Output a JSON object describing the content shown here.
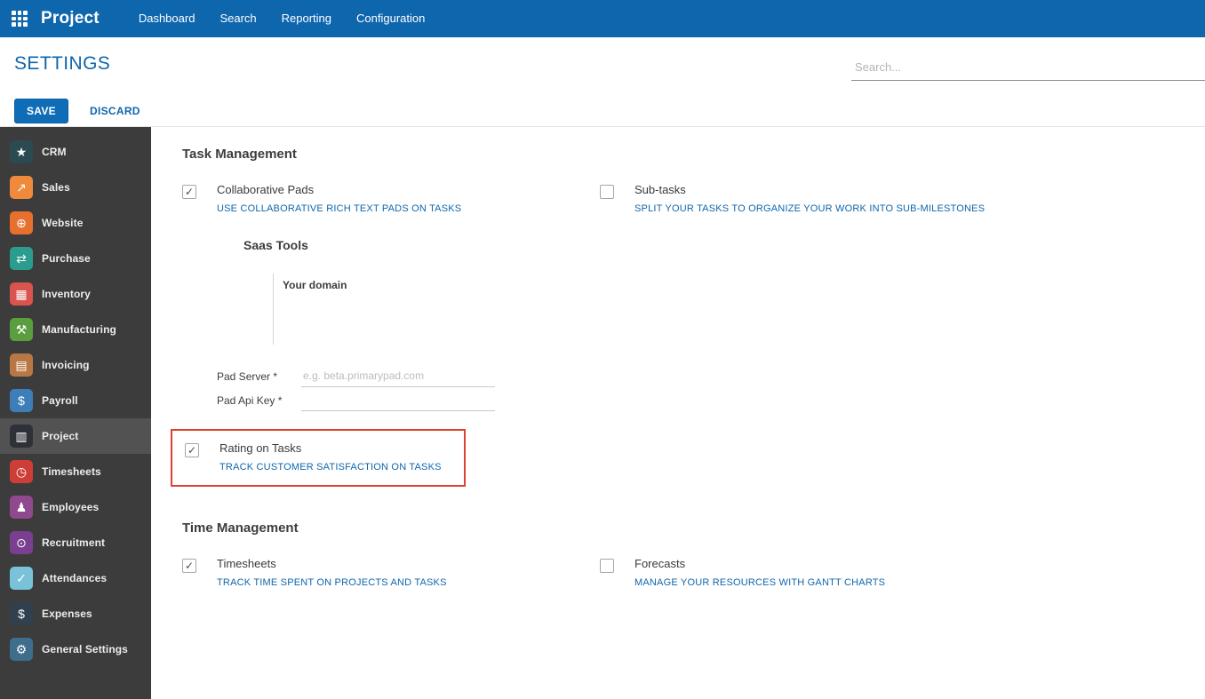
{
  "colors": {
    "navbar_blue": "#0e66ad",
    "accent_blue": "#0e66ad",
    "sidebar_bg": "#3c3c3c",
    "sidebar_selected": "#525252",
    "highlight_red": "#e1402f"
  },
  "navbar": {
    "title": "Project",
    "menus": [
      "Dashboard",
      "Search",
      "Reporting",
      "Configuration"
    ]
  },
  "header": {
    "title": "SETTINGS",
    "search_placeholder": "Search..."
  },
  "actions": {
    "save": "SAVE",
    "discard": "DISCARD"
  },
  "sidebar": {
    "items": [
      {
        "label": "CRM",
        "glyph": "★",
        "color": "#2c4a52"
      },
      {
        "label": "Sales",
        "glyph": "↗",
        "color": "#ef8a3c"
      },
      {
        "label": "Website",
        "glyph": "⊕",
        "color": "#e7702e"
      },
      {
        "label": "Purchase",
        "glyph": "⇄",
        "color": "#2a9d8f"
      },
      {
        "label": "Inventory",
        "glyph": "▦",
        "color": "#d9534f"
      },
      {
        "label": "Manufacturing",
        "glyph": "⚒",
        "color": "#5a9e3f"
      },
      {
        "label": "Invoicing",
        "glyph": "▤",
        "color": "#b97745"
      },
      {
        "label": "Payroll",
        "glyph": "$",
        "color": "#3d7eb8"
      },
      {
        "label": "Project",
        "glyph": "▥",
        "color": "#2e3138",
        "selected": true
      },
      {
        "label": "Timesheets",
        "glyph": "◷",
        "color": "#cf3e36"
      },
      {
        "label": "Employees",
        "glyph": "♟",
        "color": "#8f4a8f"
      },
      {
        "label": "Recruitment",
        "glyph": "⊙",
        "color": "#7a3f8f"
      },
      {
        "label": "Attendances",
        "glyph": "✓",
        "color": "#79c2d9"
      },
      {
        "label": "Expenses",
        "glyph": "$",
        "color": "#30404f"
      },
      {
        "label": "General Settings",
        "glyph": "⚙",
        "color": "#3f6e8c"
      }
    ]
  },
  "main": {
    "task_management": {
      "title": "Task Management",
      "collaborative_pads": {
        "name": "Collaborative Pads",
        "desc": "USE COLLABORATIVE RICH TEXT PADS ON TASKS",
        "checked": true
      },
      "sub_tasks": {
        "name": "Sub-tasks",
        "desc": "SPLIT YOUR TASKS TO ORGANIZE YOUR WORK INTO SUB-MILESTONES",
        "checked": false
      },
      "saas_tools": {
        "title": "Saas Tools",
        "your_domain": "Your domain"
      },
      "pad_server": {
        "label": "Pad Server *",
        "placeholder": "e.g. beta.primarypad.com",
        "value": ""
      },
      "pad_api_key": {
        "label": "Pad Api Key *",
        "placeholder": "",
        "value": ""
      },
      "rating": {
        "name": "Rating on Tasks",
        "desc": "TRACK CUSTOMER SATISFACTION ON TASKS",
        "checked": true
      }
    },
    "time_management": {
      "title": "Time Management",
      "timesheets": {
        "name": "Timesheets",
        "desc": "TRACK TIME SPENT ON PROJECTS AND TASKS",
        "checked": true
      },
      "forecasts": {
        "name": "Forecasts",
        "desc": "MANAGE YOUR RESOURCES WITH GANTT CHARTS",
        "checked": false
      }
    }
  }
}
